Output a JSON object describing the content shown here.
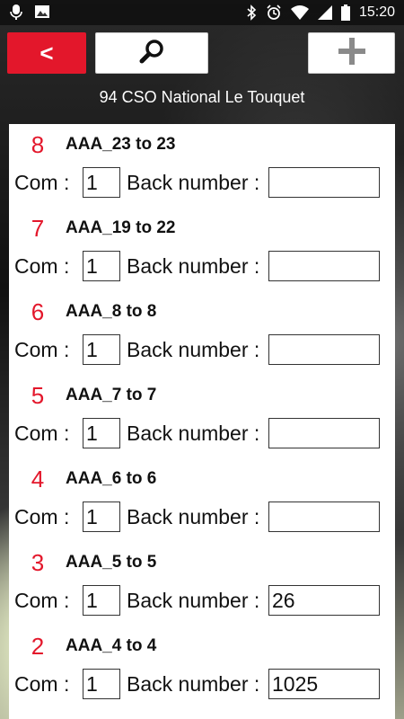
{
  "status": {
    "time": "15:20",
    "left_icons": [
      "microphone-icon",
      "image-icon"
    ],
    "right_icons": [
      "bluetooth-icon",
      "alarm-icon",
      "wifi-icon",
      "signal-icon",
      "battery-icon"
    ]
  },
  "toolbar": {
    "back_label": "<",
    "search_icon": "search-icon",
    "add_icon": "plus-icon",
    "accent": "#e3172b"
  },
  "title": "94 CSO National Le Touquet",
  "labels": {
    "com": "Com :",
    "back_number": "Back number :"
  },
  "entries": [
    {
      "number": "8",
      "range": "AAA_23 to 23",
      "com": "1",
      "back_number": ""
    },
    {
      "number": "7",
      "range": "AAA_19 to 22",
      "com": "1",
      "back_number": ""
    },
    {
      "number": "6",
      "range": "AAA_8 to 8",
      "com": "1",
      "back_number": ""
    },
    {
      "number": "5",
      "range": "AAA_7 to 7",
      "com": "1",
      "back_number": ""
    },
    {
      "number": "4",
      "range": "AAA_6 to 6",
      "com": "1",
      "back_number": ""
    },
    {
      "number": "3",
      "range": "AAA_5 to 5",
      "com": "1",
      "back_number": "26"
    },
    {
      "number": "2",
      "range": "AAA_4 to 4",
      "com": "1",
      "back_number": "1025"
    }
  ]
}
